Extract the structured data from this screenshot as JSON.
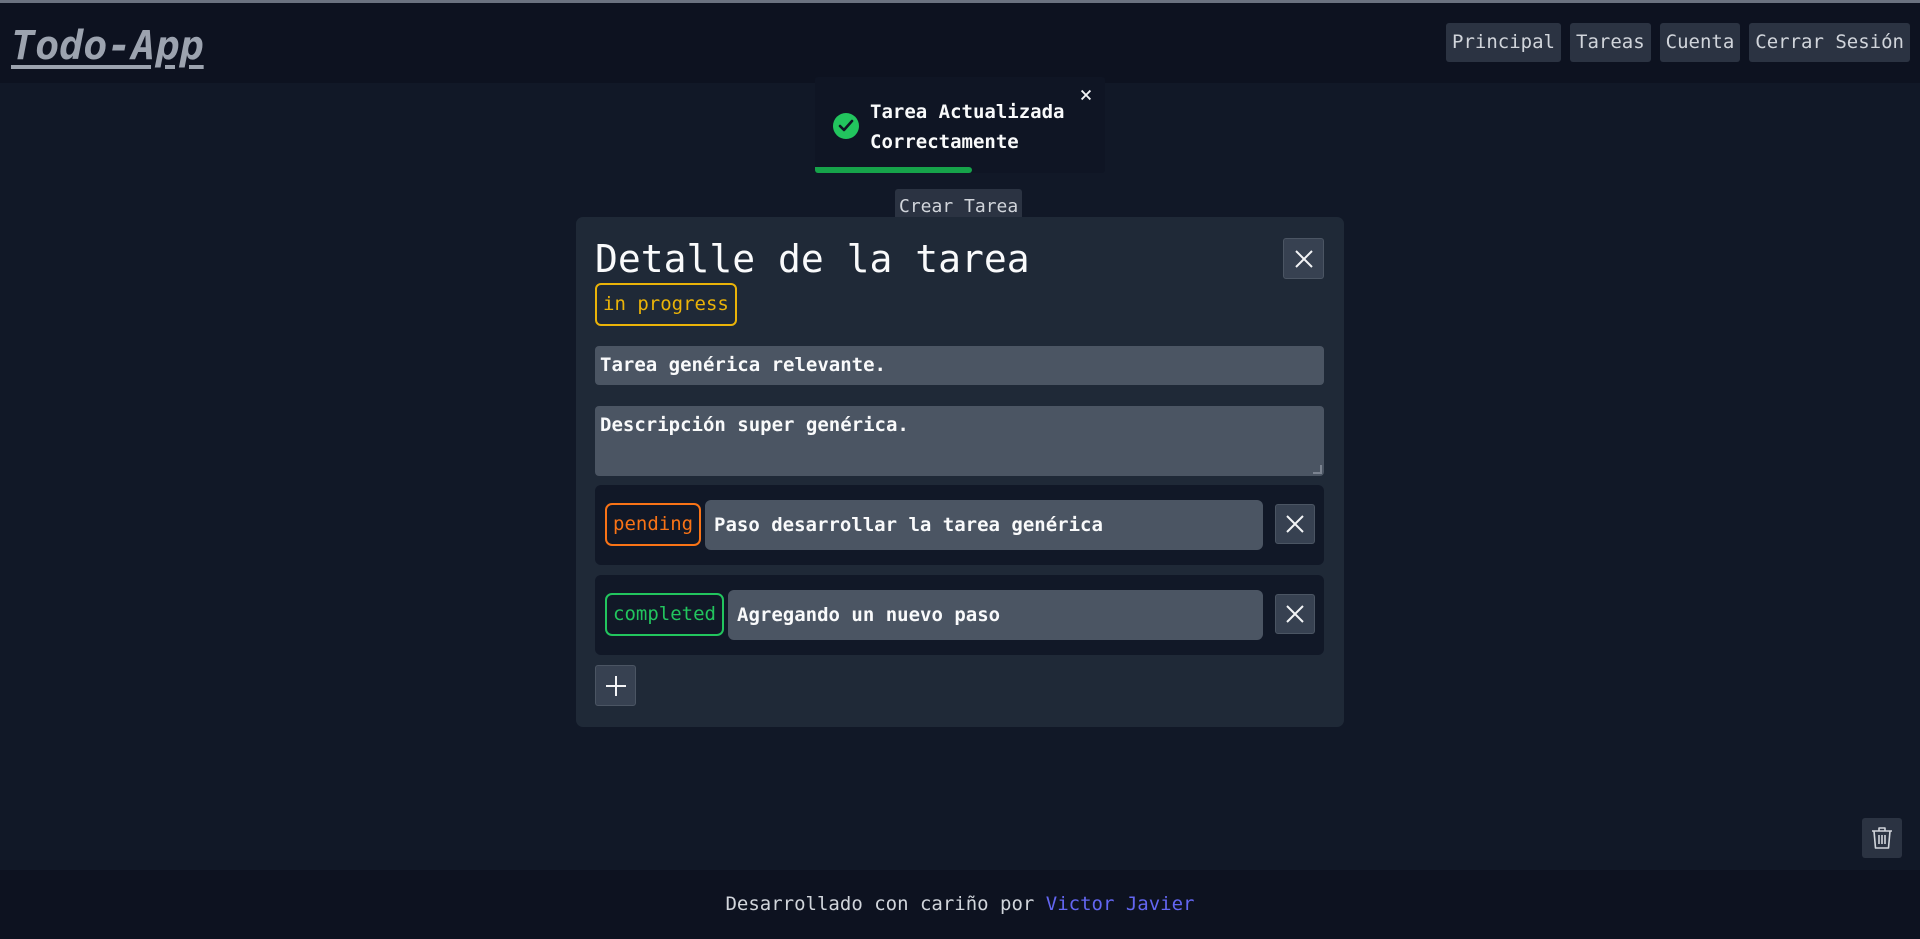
{
  "header": {
    "logo": "Todo-App",
    "nav": [
      "Principal",
      "Tareas",
      "Cuenta",
      "Cerrar Sesión"
    ]
  },
  "toast": {
    "line1": "Tarea Actualizada",
    "line2": "Correctamente",
    "progress": 0.54,
    "icon": "check-circle-icon",
    "color": "#22c55e"
  },
  "create_button": "Crear Tarea",
  "modal": {
    "title": "Detalle de la tarea",
    "status": "in progress",
    "status_color": "#eab308",
    "task_title": "Tarea genérica relevante.",
    "description": "Descripción super genérica.",
    "steps": [
      {
        "status": "pending",
        "status_color": "#f97316",
        "text": "Paso desarrollar la tarea genérica"
      },
      {
        "status": "completed",
        "status_color": "#22c55e",
        "text": "Agregando un nuevo paso"
      }
    ],
    "add_step_icon": "plus-icon",
    "close_icon": "close-icon"
  },
  "trash_icon": "trash-icon",
  "footer": {
    "text": "Desarrollado con cariño por ",
    "author": "Victor Javier",
    "author_color": "#6366f1"
  }
}
